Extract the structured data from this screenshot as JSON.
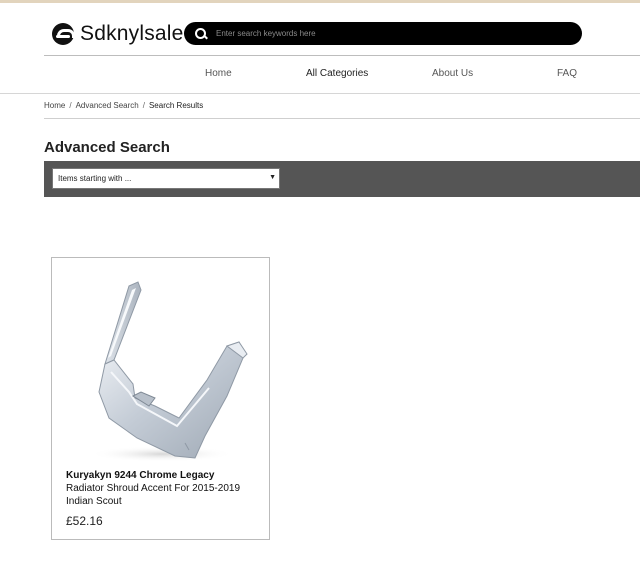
{
  "brand": {
    "name": "Sdknylsale"
  },
  "search": {
    "placeholder": "Enter search keywords here",
    "value": ""
  },
  "nav": {
    "items": [
      {
        "label": "Home"
      },
      {
        "label": "All Categories"
      },
      {
        "label": "About Us"
      },
      {
        "label": "FAQ"
      }
    ]
  },
  "breadcrumb": {
    "items": [
      {
        "label": "Home"
      },
      {
        "label": "Advanced Search"
      },
      {
        "label": "Search Results"
      }
    ],
    "separator": "/"
  },
  "page": {
    "title": "Advanced Search"
  },
  "filter": {
    "selected": "Items starting with ..."
  },
  "products": [
    {
      "title_bold": "Kuryakyn 9244 Chrome Legacy",
      "title_rest": "Radiator Shroud Accent For 2015-2019 Indian Scout",
      "price": "£52.16"
    }
  ],
  "colors": {
    "accent_stripe": "#e2d4bd",
    "filter_band": "#555555",
    "search_bar": "#000000"
  }
}
